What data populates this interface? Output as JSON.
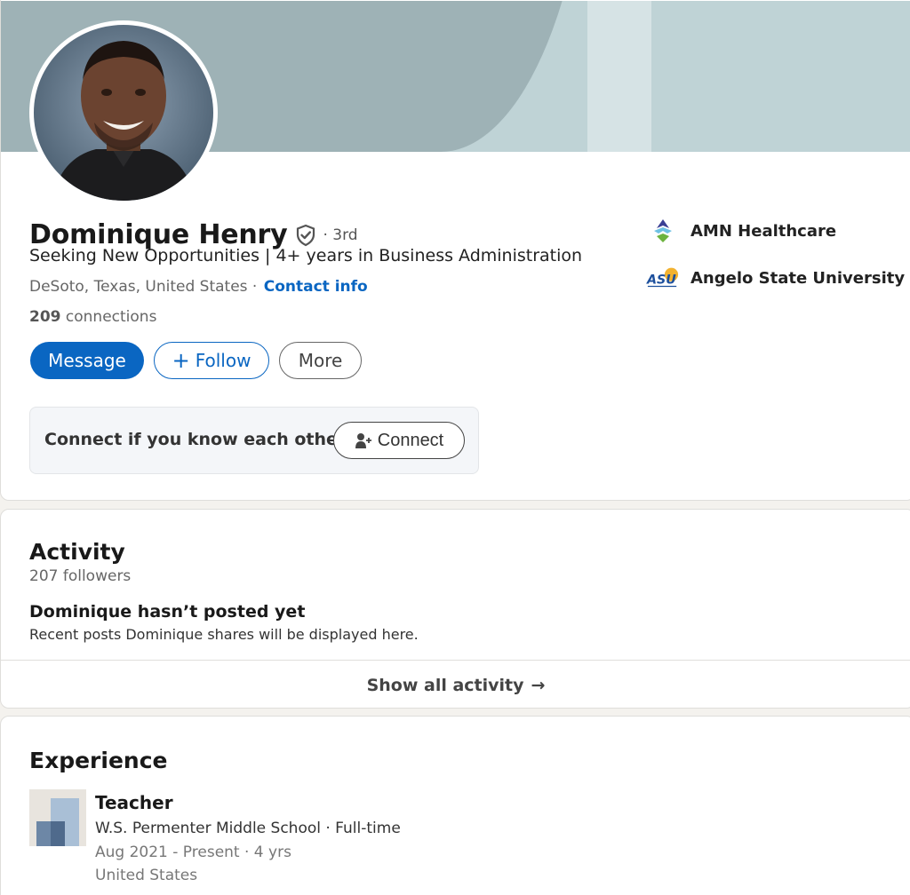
{
  "profile": {
    "name": "Dominique Henry",
    "degree": "· 3rd",
    "headline": "Seeking New Opportunities | 4+ years in Business Administration",
    "location": "DeSoto, Texas, United States",
    "location_separator": " · ",
    "contact_info_label": "Contact info",
    "connections_count": "209",
    "connections_label": " connections",
    "buttons": {
      "message": "Message",
      "follow_plus": "+",
      "follow": "Follow",
      "more": "More"
    },
    "connect_prompt": "Connect if you know each other",
    "connect_button": "Connect",
    "organizations": [
      {
        "name": "AMN Healthcare",
        "logo": "amn-healthcare-logo"
      },
      {
        "name": "Angelo State University",
        "logo": "asu-logo"
      }
    ],
    "colors": {
      "primary": "#0a66c2",
      "banner": "#9eb2b6"
    }
  },
  "activity": {
    "title": "Activity",
    "followers": "207 followers",
    "empty_title": "Dominique hasn’t posted yet",
    "empty_subtitle": "Recent posts Dominique shares will be displayed here.",
    "show_all": "Show all activity",
    "show_all_arrow": "→"
  },
  "experience": {
    "title": "Experience",
    "items": [
      {
        "title": "Teacher",
        "company": "W.S. Permenter Middle School · Full-time",
        "dates": "Aug 2021 - Present · 4 yrs",
        "location": "United States"
      }
    ]
  }
}
